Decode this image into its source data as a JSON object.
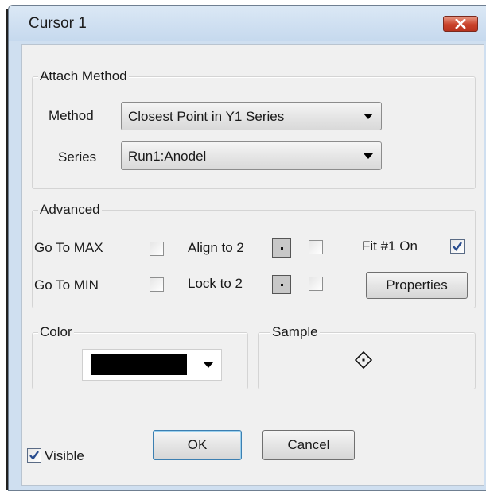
{
  "window": {
    "title": "Cursor 1"
  },
  "attach_method": {
    "group_label": "Attach Method",
    "method_label": "Method",
    "method_value": "Closest Point in Y1 Series",
    "series_label": "Series",
    "series_value": "Run1:Anodel"
  },
  "advanced": {
    "group_label": "Advanced",
    "go_to_max_label": "Go To MAX",
    "go_to_max_checked": false,
    "go_to_min_label": "Go To MIN",
    "go_to_min_checked": false,
    "align_to_2_label": "Align to 2",
    "align_to_2_checked": false,
    "lock_to_2_label": "Lock to 2",
    "lock_to_2_checked": false,
    "fit_1_on_label": "Fit #1 On",
    "fit_1_on_checked": true,
    "properties_label": "Properties"
  },
  "color": {
    "group_label": "Color",
    "value": "#000000"
  },
  "sample": {
    "group_label": "Sample",
    "icon": "diamond-point-icon"
  },
  "footer": {
    "visible_label": "Visible",
    "visible_checked": true,
    "ok_label": "OK",
    "cancel_label": "Cancel"
  },
  "colors": {
    "title_bar": "#c6d9ee",
    "close_button": "#c9432b",
    "dialog_bg": "#f0f0f0"
  }
}
